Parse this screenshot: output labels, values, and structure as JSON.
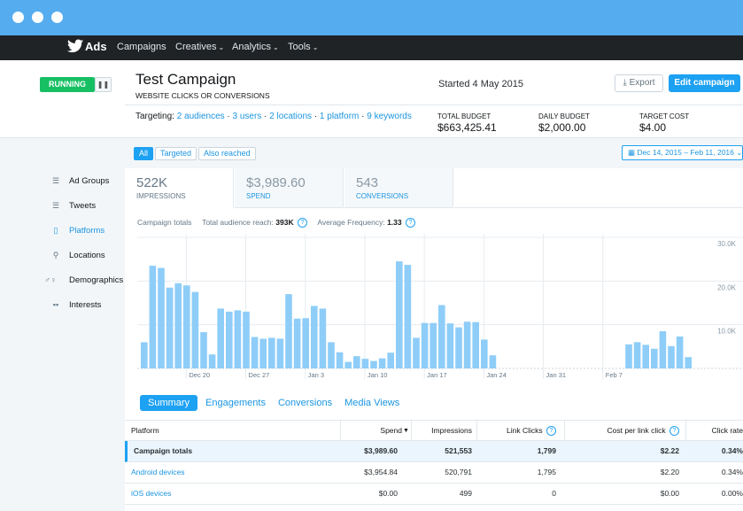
{
  "app": {
    "brand": "Ads"
  },
  "nav": {
    "items": [
      "Campaigns",
      "Creatives",
      "Analytics",
      "Tools"
    ]
  },
  "campaign": {
    "status": "RUNNING",
    "title": "Test Campaign",
    "objective": "WEBSITE CLICKS OR CONVERSIONS",
    "started": "Started 4 May 2015",
    "export_label": "Export",
    "edit_label": "Edit campaign",
    "targeting_label": "Targeting:",
    "targeting": [
      "2 audiences",
      "3 users",
      "2 locations",
      "1 platform",
      "9 keywords"
    ],
    "budgets": [
      {
        "label": "TOTAL BUDGET",
        "value": "$663,425.41"
      },
      {
        "label": "DAILY BUDGET",
        "value": "$2,000.00"
      },
      {
        "label": "TARGET COST",
        "value": "$4.00"
      }
    ]
  },
  "filters": [
    "All",
    "Targeted",
    "Also reached"
  ],
  "daterange": "Dec 14, 2015 – Feb 11, 2016",
  "sidebar": {
    "items": [
      {
        "label": "Ad Groups",
        "icon": "list-icon"
      },
      {
        "label": "Tweets",
        "icon": "list-icon"
      },
      {
        "label": "Platforms",
        "icon": "mobile-icon"
      },
      {
        "label": "Locations",
        "icon": "pin-icon"
      },
      {
        "label": "Demographics",
        "icon": "gender-icon"
      },
      {
        "label": "Interests",
        "icon": "grid-icon"
      }
    ]
  },
  "metrics": [
    {
      "value": "522K",
      "label": "IMPRESSIONS"
    },
    {
      "value": "$3,989.60",
      "label": "SPEND"
    },
    {
      "value": "543",
      "label": "CONVERSIONS"
    }
  ],
  "totals": {
    "label": "Campaign totals",
    "reach_label": "Total audience reach:",
    "reach_value": "393K",
    "freq_label": "Average Frequency:",
    "freq_value": "1.33"
  },
  "chart_data": {
    "type": "bar",
    "ylim": [
      0,
      30000
    ],
    "yticks": [
      "30.0K",
      "20.0K",
      "10.0K"
    ],
    "xticks": [
      "Dec 20",
      "Dec 27",
      "Jan 3",
      "Jan 10",
      "Jan 17",
      "Jan 24",
      "Jan 31",
      "Feb 7"
    ],
    "values": [
      6000,
      23500,
      23000,
      18500,
      19500,
      19000,
      17500,
      8300,
      3200,
      13700,
      13000,
      13300,
      13000,
      7200,
      6800,
      7000,
      6800,
      17000,
      11400,
      11500,
      14300,
      13700,
      6000,
      3700,
      1500,
      2800,
      2200,
      1700,
      2300,
      3600,
      24500,
      23700,
      7000,
      10400,
      10400,
      14500,
      10300,
      9400,
      10700,
      10600,
      6600,
      3000,
      0,
      0,
      0,
      0,
      0,
      0,
      0,
      0,
      0,
      0,
      0,
      0,
      0,
      0,
      0,
      5500,
      6000,
      5400,
      4500,
      8500,
      5100,
      7300,
      2600
    ]
  },
  "subtabs": [
    "Summary",
    "Engagements",
    "Conversions",
    "Media Views"
  ],
  "table": {
    "headers": [
      "Platform",
      "Spend",
      "Impressions",
      "Link Clicks",
      "Cost per link click",
      "Click rate"
    ],
    "rows": [
      [
        "Campaign totals",
        "$3,989.60",
        "521,553",
        "1,799",
        "$2.22",
        "0.34%"
      ],
      [
        "Android devices",
        "$3,954.84",
        "520,791",
        "1,795",
        "$2.20",
        "0.34%"
      ],
      [
        "iOS devices",
        "$0.00",
        "499",
        "0",
        "$0.00",
        "0.00%"
      ]
    ]
  },
  "colors": {
    "accent": "#1da1f2",
    "bar": "#8ecdf8",
    "running": "#17bf63",
    "topbar": "#55acee"
  }
}
